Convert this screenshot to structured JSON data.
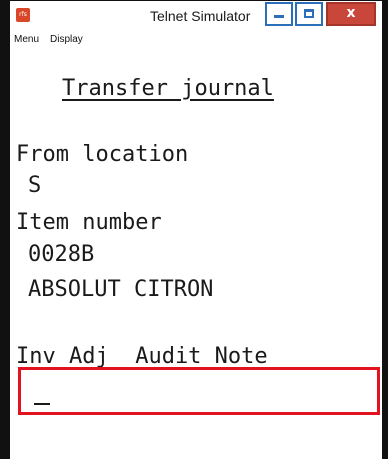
{
  "window": {
    "title": "Telnet Simulator",
    "icon_text": "rfs",
    "controls": {
      "minimize_icon": "minimize-icon",
      "maximize_icon": "maximize-icon",
      "close_symbol": "x"
    },
    "accent_color": "#2b6fb8",
    "close_color": "#c8463a"
  },
  "menubar": {
    "items": [
      "Menu",
      "Display"
    ]
  },
  "terminal": {
    "screen_title": "Transfer journal",
    "from_location_label": "From location",
    "from_location_value": "S",
    "item_number_label": "Item number",
    "item_number_value": "0028B",
    "item_description": "ABSOLUT CITRON",
    "inv_adj_label": "Inv Adj  Audit Note",
    "highlight_color": "#e2121f"
  }
}
